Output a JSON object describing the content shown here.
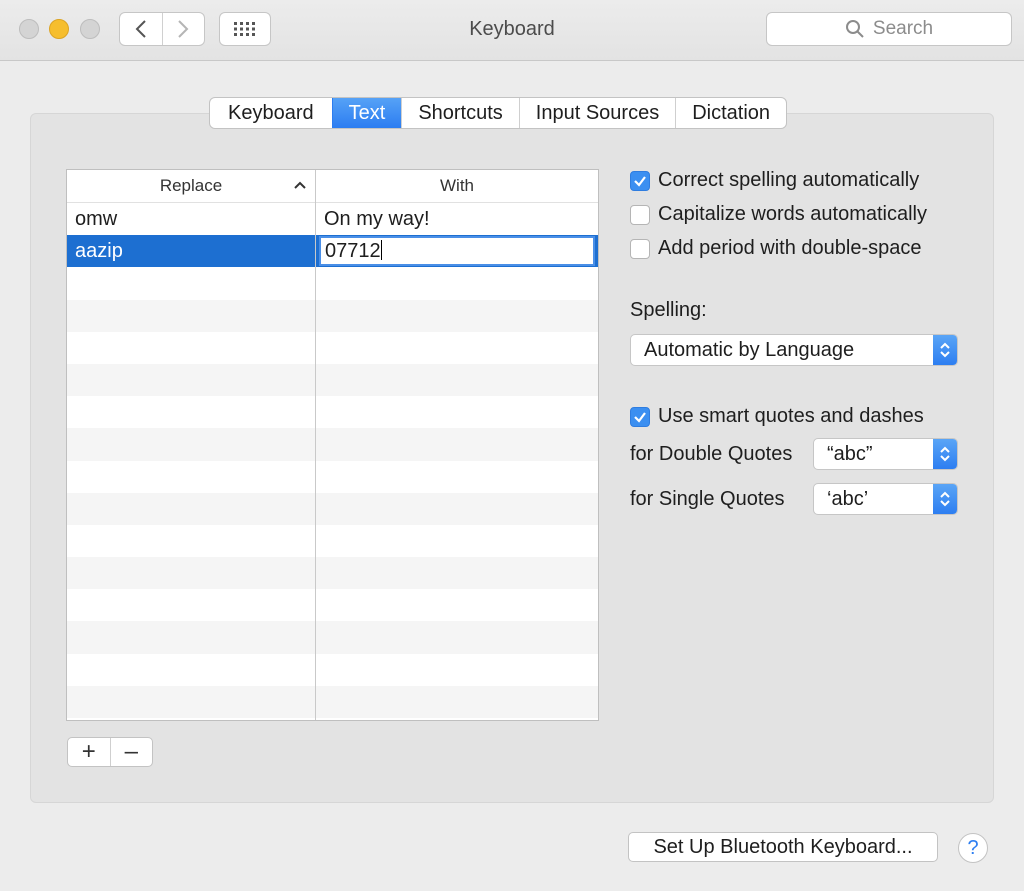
{
  "window": {
    "title": "Keyboard",
    "search_placeholder": "Search"
  },
  "tabs": [
    {
      "label": "Keyboard",
      "active": false
    },
    {
      "label": "Text",
      "active": true
    },
    {
      "label": "Shortcuts",
      "active": false
    },
    {
      "label": "Input Sources",
      "active": false
    },
    {
      "label": "Dictation",
      "active": false
    }
  ],
  "table": {
    "headers": [
      "Replace",
      "With"
    ],
    "rows": [
      {
        "replace": "omw",
        "with": "On my way!"
      },
      {
        "replace": "aazip",
        "with": "07712",
        "selected": true,
        "editing": true
      }
    ]
  },
  "options": {
    "correct_spelling": {
      "label": "Correct spelling automatically",
      "checked": true
    },
    "capitalize_words": {
      "label": "Capitalize words automatically",
      "checked": false
    },
    "add_period": {
      "label": "Add period with double-space",
      "checked": false
    },
    "spelling_label": "Spelling:",
    "spelling_value": "Automatic by Language",
    "smart_quotes": {
      "label": "Use smart quotes and dashes",
      "checked": true
    },
    "double_quotes_label": "for Double Quotes",
    "double_quotes_value": "“abc”",
    "single_quotes_label": "for Single Quotes",
    "single_quotes_value": "‘abc’"
  },
  "buttons": {
    "add": "+",
    "remove": "–",
    "bluetooth": "Set Up Bluetooth Keyboard...",
    "help": "?"
  },
  "colors": {
    "accent": "#2c7df1",
    "selection": "#1d6fd1"
  }
}
